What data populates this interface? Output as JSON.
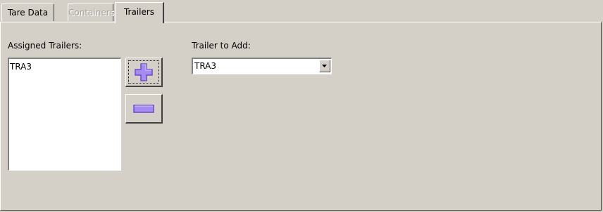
{
  "tabs": [
    {
      "label": "Tare Data",
      "state": "normal"
    },
    {
      "label": "Containers",
      "state": "disabled"
    },
    {
      "label": "Trailers",
      "state": "active"
    }
  ],
  "assigned": {
    "label": "Assigned Trailers:",
    "items": [
      "TRA3"
    ]
  },
  "add_button": {
    "icon": "plus-icon"
  },
  "remove_button": {
    "icon": "minus-icon"
  },
  "trailer_to_add": {
    "label": "Trailer to Add:",
    "selected": "TRA3"
  },
  "colors": {
    "background": "#d4d0c8",
    "icon_fill": "#a68cf0",
    "icon_stroke": "#6a4bc8"
  }
}
